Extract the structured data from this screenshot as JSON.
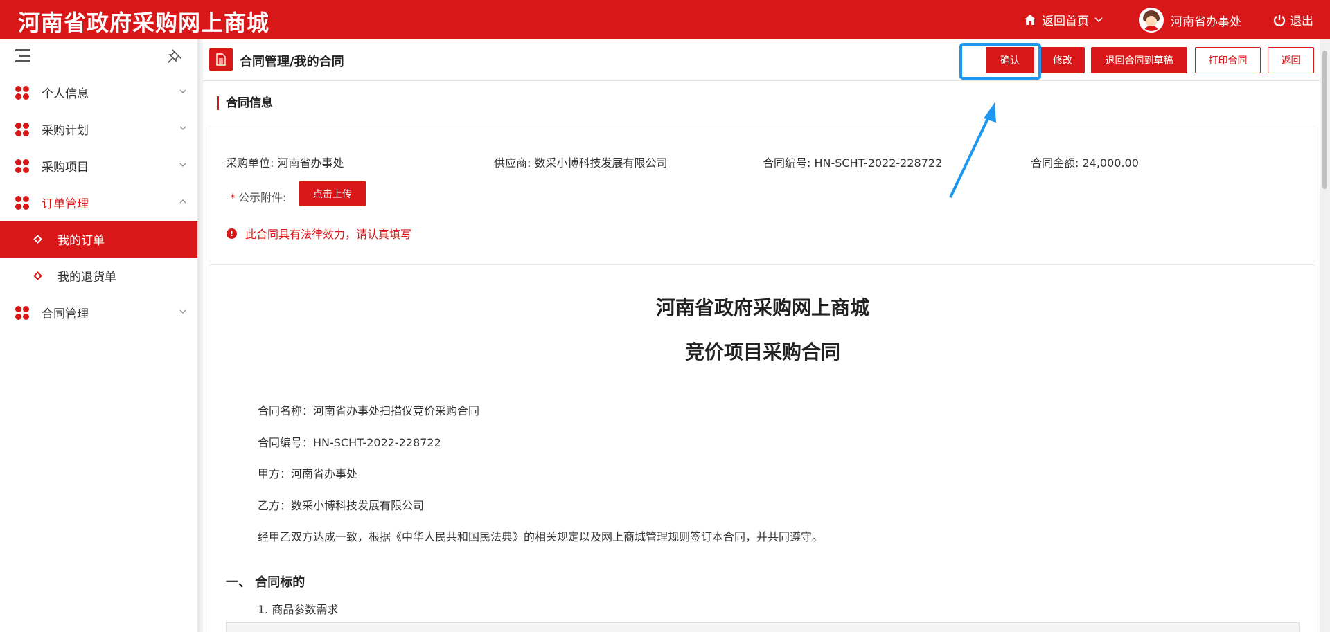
{
  "app": {
    "brand_title": "河南省政府采购网上商城",
    "home_link": "返回首页",
    "user_name": "河南省办事处",
    "logout": "退出"
  },
  "sidebar": {
    "items": [
      {
        "label": "个人信息"
      },
      {
        "label": "采购计划"
      },
      {
        "label": "采购项目"
      },
      {
        "label": "订单管理"
      },
      {
        "label": "合同管理"
      }
    ],
    "subitems": [
      {
        "label": "我的订单"
      },
      {
        "label": "我的退货单"
      }
    ]
  },
  "header": {
    "breadcrumb": "合同管理/我的合同",
    "buttons": {
      "confirm": "确认",
      "modify": "修改",
      "return_draft": "退回合同到草稿",
      "print": "打印合同",
      "back": "返回"
    }
  },
  "contract_info": {
    "section_title": "合同信息",
    "buyer": "采购单位: 河南省办事处",
    "supplier": "供应商: 数采小博科技发展有限公司",
    "contract_no": "合同编号: HN-SCHT-2022-228722",
    "amount": "合同金额: 24,000.00",
    "attachment_label": "公示附件:",
    "required_mark": "*",
    "upload_button": "点击上传",
    "warning": "此合同具有法律效力，请认真填写"
  },
  "contract_doc": {
    "title1": "河南省政府采购网上商城",
    "title2": "竞价项目采购合同",
    "lines": [
      "合同名称：河南省办事处扫描仪竞价采购合同",
      "合同编号：HN-SCHT-2022-228722",
      "甲方：河南省办事处",
      "乙方：数采小博科技发展有限公司",
      "经甲乙双方达成一致，根据《中华人民共和国民法典》的相关规定以及网上商城管理规则签订本合同，并共同遵守。"
    ],
    "section1": "一、 合同标的",
    "section1_sub": "1. 商品参数需求"
  },
  "colors": {
    "brand_red": "#d71718",
    "highlight_blue": "#1e97f0"
  }
}
